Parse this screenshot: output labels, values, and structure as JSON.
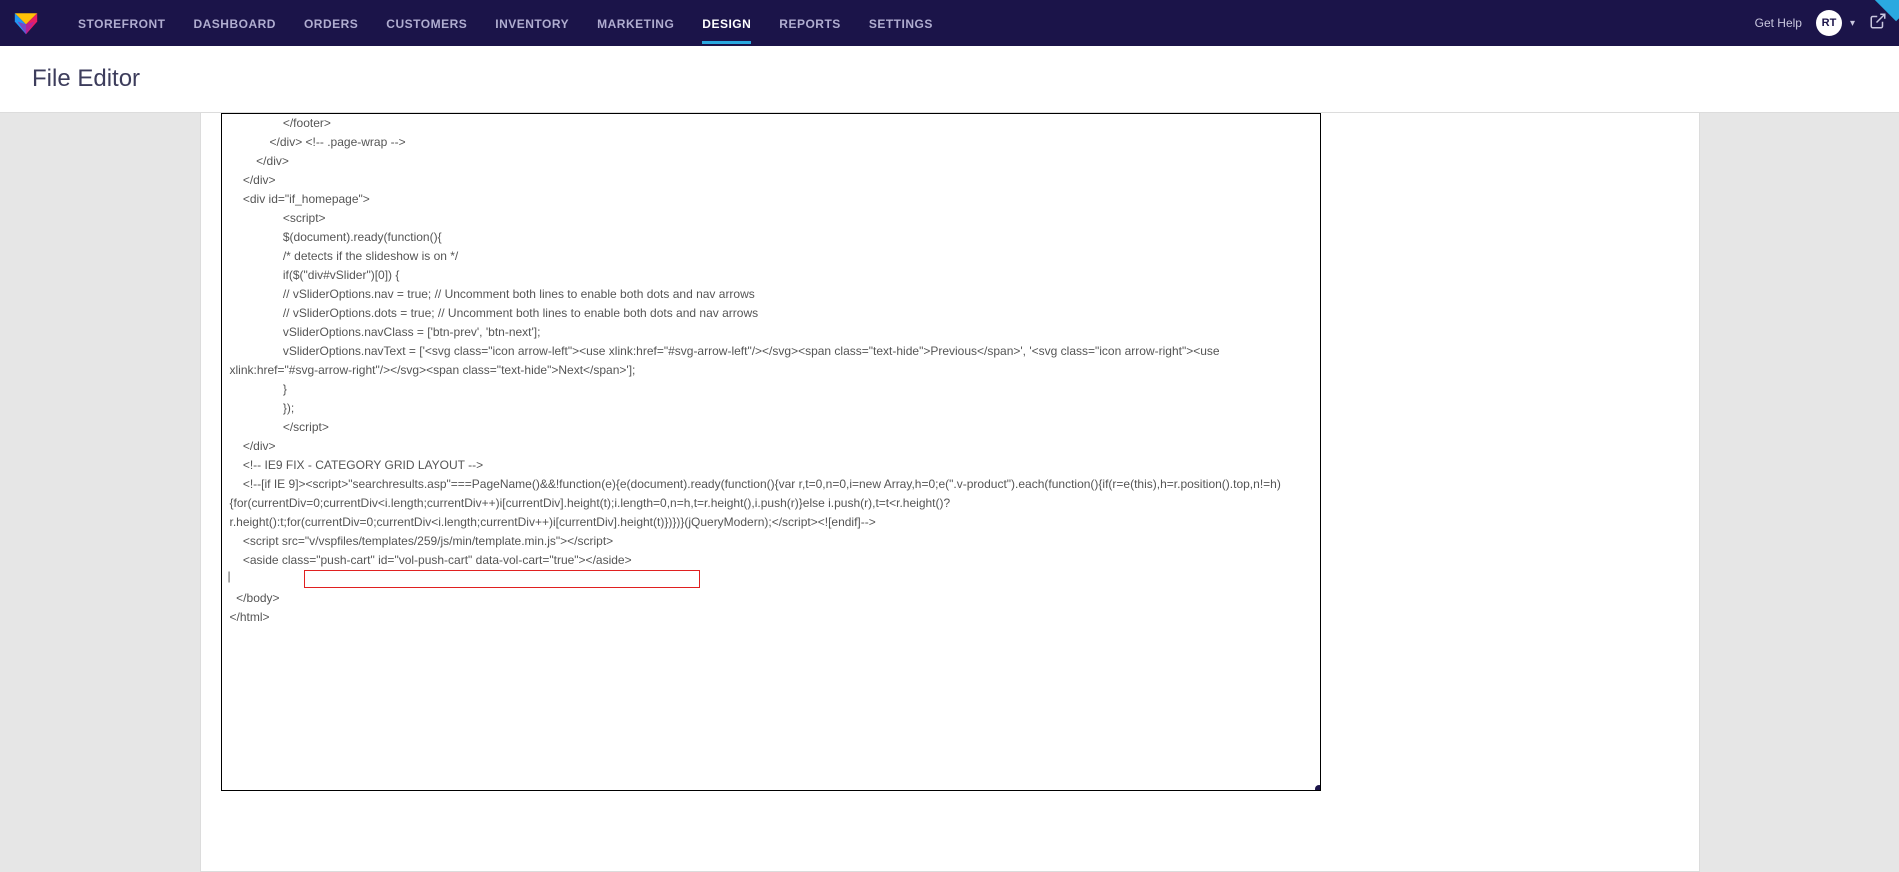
{
  "nav": {
    "items": [
      {
        "label": "STOREFRONT"
      },
      {
        "label": "DASHBOARD"
      },
      {
        "label": "ORDERS"
      },
      {
        "label": "CUSTOMERS"
      },
      {
        "label": "INVENTORY"
      },
      {
        "label": "MARKETING"
      },
      {
        "label": "DESIGN"
      },
      {
        "label": "REPORTS"
      },
      {
        "label": "SETTINGS"
      }
    ],
    "active_index": 6
  },
  "topbar_right": {
    "gethelp": "Get Help",
    "avatar_initials": "RT"
  },
  "page": {
    "title": "File Editor"
  },
  "code": {
    "lines": [
      "                </footer>",
      "            </div> <!-- .page-wrap -->",
      "        </div>",
      "    </div>",
      "    <div id=\"if_homepage\">",
      "                <script>",
      "                $(document).ready(function(){",
      "                /* detects if the slideshow is on */",
      "                if($(\"div#vSlider\")[0]) {",
      "                // vSliderOptions.nav = true; // Uncomment both lines to enable both dots and nav arrows",
      "                // vSliderOptions.dots = true; // Uncomment both lines to enable both dots and nav arrows",
      "                vSliderOptions.navClass = ['btn-prev', 'btn-next'];",
      "                vSliderOptions.navText = ['<svg class=\"icon arrow-left\"><use xlink:href=\"#svg-arrow-left\"/></svg><span class=\"text-hide\">Previous</span>', '<svg class=\"icon arrow-right\"><use xlink:href=\"#svg-arrow-right\"/></svg><span class=\"text-hide\">Next</span>'];",
      "                }",
      "                });",
      "                </script​>",
      "    </div>",
      "    <!-- IE9 FIX - CATEGORY GRID LAYOUT -->",
      "    <!--[if IE 9]><script>\"searchresults.asp\"===PageName()&&!function(e){e(document).ready(function(){var r,t=0,n=0,i=new Array,h=0;e(\".v-product\").each(function(){if(r=e(this),h=r.position().top,n!=h){for(currentDiv=0;currentDiv<i.length;currentDiv++)i[currentDiv].height(t);i.length=0,n=h,t=r.height(),i.push(r)}else i.push(r),t=t<r.height()?r.height():t;for(currentDiv=0;currentDiv<i.length;currentDiv++)i[currentDiv].height(t)})})}(jQueryModern);</script​><![endif]-->",
      "    <script src=\"v/vspfiles/templates/259/js/min/template.min.js\"></script​>",
      "    <aside class=\"push-cart\" id=\"vol-push-cart\" data-vol-cart=\"true\"></aside>",
      "",
      "  </body>",
      "</html>"
    ]
  }
}
